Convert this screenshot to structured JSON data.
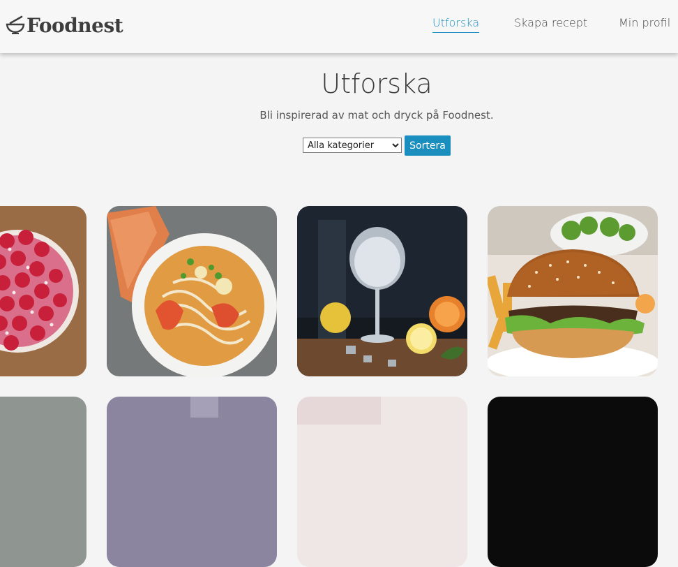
{
  "header": {
    "logo_text": "Foodnest",
    "nav": [
      {
        "label": "Utforska",
        "active": true
      },
      {
        "label": "Skapa recept",
        "active": false
      },
      {
        "label": "Min profil",
        "active": false
      }
    ]
  },
  "main": {
    "title": "Utforska",
    "subtitle": "Bli inspirerad av mat och dryck på Foodnest.",
    "filter": {
      "selected": "Alla kategorier",
      "options": [
        "Alla kategorier"
      ],
      "sort_label": "Sortera"
    },
    "cards": [
      {
        "subject": "strawberry-tart"
      },
      {
        "subject": "noodle-soup"
      },
      {
        "subject": "gin-tonic"
      },
      {
        "subject": "burger"
      },
      {
        "subject": "food-photo"
      },
      {
        "subject": "food-photo"
      },
      {
        "subject": "food-photo"
      },
      {
        "subject": "food-photo"
      }
    ]
  },
  "colors": {
    "accent": "#1a8fbf",
    "text": "#3a3a3a",
    "background": "#f4f4f4"
  }
}
